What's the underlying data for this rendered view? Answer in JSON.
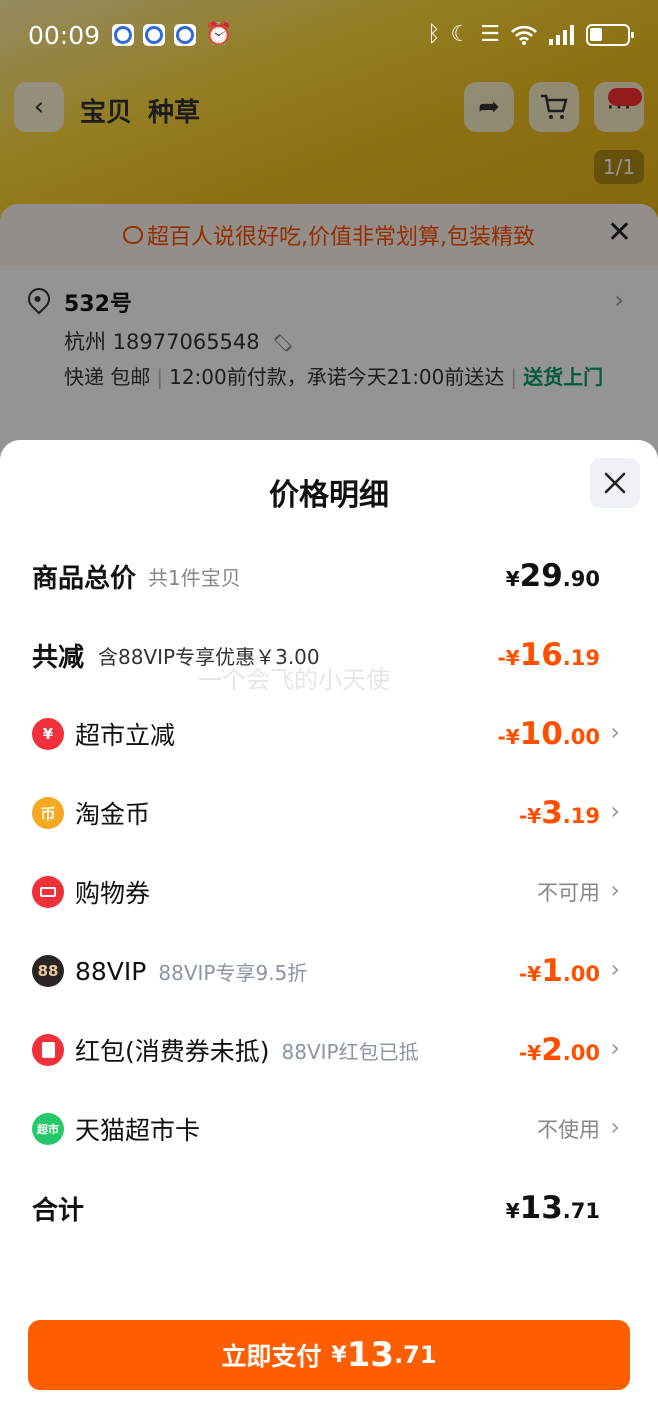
{
  "status_bar": {
    "time": "00:09",
    "icons": [
      "taobao-app-icon",
      "browser-app-icon",
      "taobao-app-icon",
      "alarm-icon"
    ],
    "right_icons": [
      "bluetooth-icon",
      "moon-icon",
      "vibrate-icon",
      "wifi-icon",
      "signal-icon",
      "battery-icon"
    ]
  },
  "product_nav": {
    "tabs": [
      "宝贝",
      "种草"
    ],
    "pager": "1/1"
  },
  "order": {
    "banner_text": "超百人说很好吃,价值非常划算,包装精致",
    "address_title": "532号",
    "address_phone": "杭州  18977065548",
    "shipping_method": "快递 包邮",
    "shipping_promise": "12:00前付款，承诺今天21:00前送达",
    "shipping_tag": "送货上门"
  },
  "sheet": {
    "title": "价格明细",
    "rows": {
      "total": {
        "label": "商品总价",
        "sub": "共1件宝贝",
        "cur": "¥",
        "int": "29",
        "dec": ".90"
      },
      "discount": {
        "label": "共减",
        "sub": "含88VIP专享优惠￥3.00",
        "cur": "-¥",
        "int": "16",
        "dec": ".19"
      },
      "supermarket": {
        "label": "超市立减",
        "cur": "-¥",
        "int": "10",
        "dec": ".00",
        "icon": "yuan-discount-icon",
        "color": "#f0303a"
      },
      "coins": {
        "label": "淘金币",
        "cur": "-¥",
        "int": "3",
        "dec": ".19",
        "icon": "coin-icon",
        "icon_text": "币",
        "color": "#f7a823"
      },
      "coupon": {
        "label": "购物券",
        "status": "不可用",
        "icon": "ticket-icon",
        "color": "#f0303a"
      },
      "vip": {
        "label": "88VIP",
        "sub": "88VIP专享9.5折",
        "cur": "-¥",
        "int": "1",
        "dec": ".00",
        "icon": "vip88-icon",
        "icon_text": "88",
        "color": "#2a2522"
      },
      "redpacket": {
        "label": "红包(消费券未抵)",
        "sub": "88VIP红包已抵",
        "cur": "-¥",
        "int": "2",
        "dec": ".00",
        "icon": "red-packet-icon",
        "color": "#f0303a"
      },
      "card": {
        "label": "天猫超市卡",
        "status": "不使用",
        "icon": "tmall-card-icon",
        "icon_text": "超市",
        "color": "#26c96a"
      },
      "sum": {
        "label": "合计",
        "cur": "¥",
        "int": "13",
        "dec": ".71"
      }
    },
    "watermark": "一个会飞的小天使"
  },
  "pay_button": {
    "label": "立即支付",
    "cur": "¥",
    "int": "13",
    "dec": ".71"
  },
  "colors": {
    "accent": "#ff5e00",
    "negative": "#ff5000",
    "green": "#0a9e5f"
  }
}
